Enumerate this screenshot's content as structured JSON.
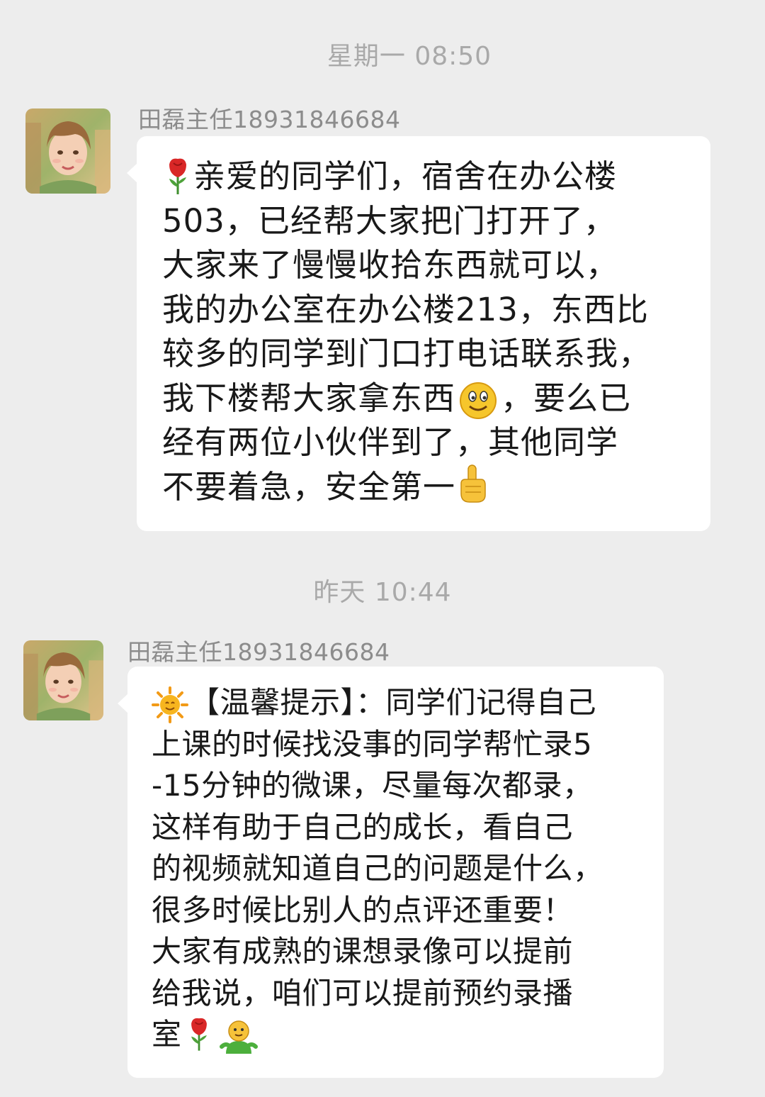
{
  "conversation": {
    "messages": [
      {
        "timestamp": "星期一 08:50",
        "sender": "田磊主任18931846684",
        "lines": [
          "亲爱的同学们，宿舍在办公楼",
          "503，已经帮大家把门打开了，",
          "大家来了慢慢收拾东西就可以，",
          "我的办公室在办公楼213，东西比",
          "较多的同学到门口打电话联系我，",
          "我下楼帮大家拿东西",
          "，要么已",
          "经有两位小伙伴到了，其他同学",
          "不要着急，安全第一"
        ],
        "emojis": [
          "rose-emoji",
          "smile-emoji",
          "point-up-emoji"
        ]
      },
      {
        "timestamp": "昨天 10:44",
        "sender": "田磊主任18931846684",
        "lines": [
          "【温馨提示】：同学们记得自己",
          "上课的时候找没事的同学帮忙录5",
          "-15分钟的微课，尽量每次都录，",
          "这样有助于自己的成长，看自己",
          "的视频就知道自己的问题是什么，",
          "很多时候比别人的点评还重要！",
          "大家有成熟的课想录像可以提前",
          "给我说，咱们可以提前预约录播",
          "室"
        ],
        "emojis": [
          "sun-emoji",
          "rose-emoji",
          "person-emoji"
        ]
      }
    ]
  },
  "colors": {
    "background": "#ededed",
    "bubble": "#ffffff",
    "timestamp": "#a9a9a9",
    "sender": "#8c8c8c",
    "text": "#191919"
  }
}
